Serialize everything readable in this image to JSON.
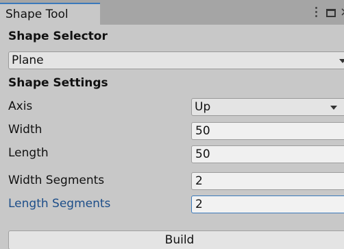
{
  "window": {
    "tab_title": "Shape Tool",
    "close_glyph": "×"
  },
  "shape_selector": {
    "title": "Shape Selector",
    "selected": "Plane"
  },
  "shape_settings": {
    "title": "Shape Settings",
    "axis": {
      "label": "Axis",
      "value": "Up"
    },
    "width": {
      "label": "Width",
      "value": "50"
    },
    "length": {
      "label": "Length",
      "value": "50"
    },
    "width_segments": {
      "label": "Width Segments",
      "value": "2"
    },
    "length_segments": {
      "label": "Length Segments",
      "value": "2"
    }
  },
  "actions": {
    "build_label": "Build"
  },
  "colors": {
    "accent": "#3a79bb",
    "focused_label": "#1d4e89",
    "panel_bg": "#c8c8c8",
    "tabbar_bg": "#a5a5a5"
  },
  "icons": [
    "kebab-menu-icon",
    "maximize-icon",
    "close-icon",
    "dropdown-arrow-icon"
  ]
}
